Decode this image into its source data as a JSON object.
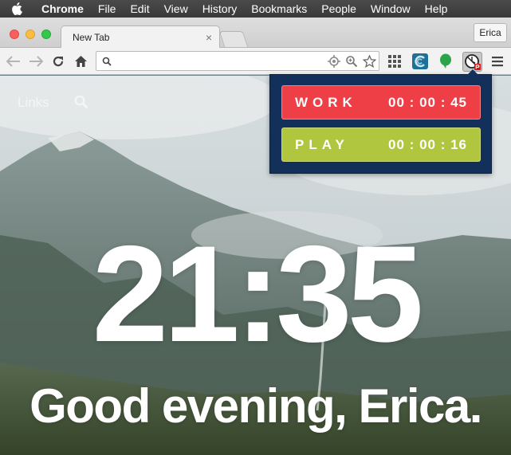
{
  "menubar": {
    "app": "Chrome",
    "items": [
      "File",
      "Edit",
      "View",
      "History",
      "Bookmarks",
      "People",
      "Window",
      "Help"
    ]
  },
  "browser": {
    "tab_title": "New Tab",
    "tab_close": "×",
    "profile_name": "Erica",
    "omnibox_value": "",
    "omnibox_placeholder": ""
  },
  "newtab_page": {
    "links_label": "Links",
    "clock": "21:35",
    "greeting": "Good evening, Erica."
  },
  "timer_popup": {
    "work": {
      "label": "WORK",
      "time": "00 : 00 : 45",
      "color": "#ee3f46"
    },
    "play": {
      "label": "PLAY",
      "time": "00 : 00 : 16",
      "color": "#b0c63f"
    },
    "background": "#13305a"
  },
  "icons": [
    "apple-icon",
    "back-icon",
    "forward-icon",
    "reload-icon",
    "home-icon",
    "search-icon",
    "location-target-icon",
    "zoom-icon",
    "bookmark-star-icon",
    "apps-grid-icon",
    "extension-c-icon",
    "extension-green-icon",
    "timer-extension-icon",
    "menu-icon"
  ]
}
